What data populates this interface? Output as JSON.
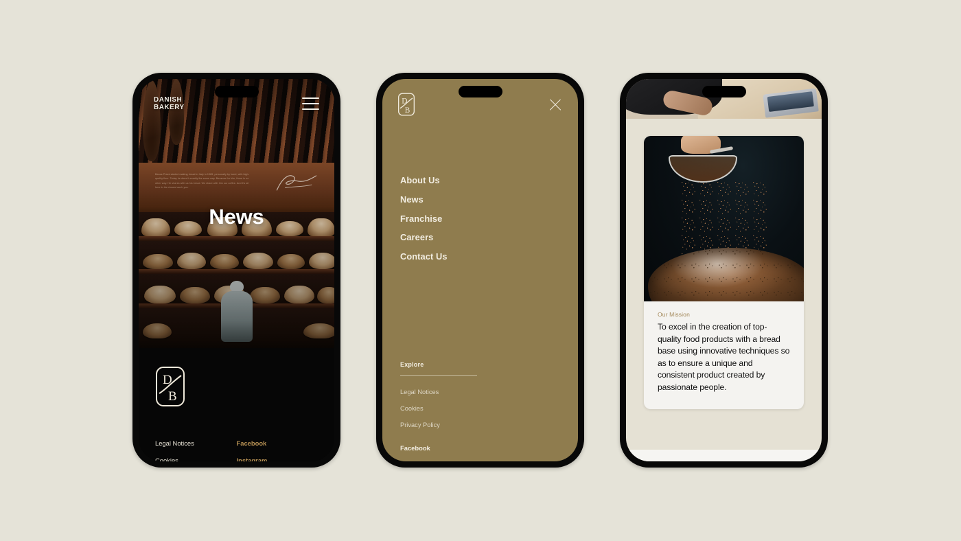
{
  "canvas": {
    "background_color": "#e5e3d8",
    "gold_color": "#8f7c4e",
    "cream_color": "#e5e1d4",
    "accent_gold_text": "#b79154"
  },
  "phone1": {
    "name": "homepage-news-screen",
    "brand": {
      "line1": "DANISH",
      "line2": "BAKERY"
    },
    "menu_icon": "hamburger-icon",
    "hero_title": "News",
    "hero_wall_text": "Banos Priani started making bread in Italy in 1985, personally by hand, with high-quality flour. Today he does it exactly the same way. Because for him, there is no other way. He shares with us his bread. We share with him our coffee. And it's all here in the closest auch you.",
    "logo": {
      "top_letter": "D",
      "bottom_letter": "B"
    },
    "footer_links_left": [
      "Legal Notices",
      "Cookies"
    ],
    "footer_links_right": [
      "Facebook",
      "Instagram"
    ]
  },
  "phone2": {
    "name": "navigation-menu-screen",
    "logo": {
      "top_letter": "D",
      "bottom_letter": "B"
    },
    "close_icon": "close-icon",
    "nav_items": [
      "About Us",
      "News",
      "Franchise",
      "Careers",
      "Contact Us"
    ],
    "explore_title": "Explore",
    "explore_links": [
      "Legal Notices",
      "Cookies",
      "Privacy Policy"
    ],
    "social_links": [
      "Facebook"
    ]
  },
  "phone3": {
    "name": "our-mission-screen",
    "top_photo_alt": "workspace-photo",
    "card_photo_alt": "cocoa-sifting-photo",
    "mission_kicker": "Our Mission",
    "mission_body": "To excel in the creation of top-quality food products with a bread base using innovative techniques so as to ensure a unique and consistent product created by passionate people."
  }
}
